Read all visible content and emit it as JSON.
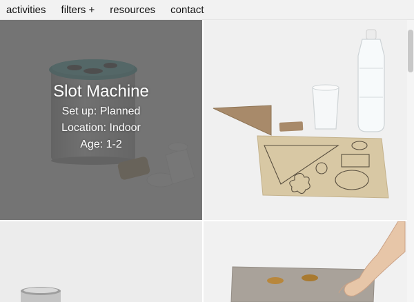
{
  "nav": {
    "items": [
      {
        "label": "activities"
      },
      {
        "label": "filters +"
      },
      {
        "label": "resources"
      },
      {
        "label": "contact"
      }
    ]
  },
  "tiles": [
    {
      "overlay": {
        "title": "Slot Machine",
        "setup": "Set up: Planned",
        "location": "Location: Indoor",
        "age": "Age: 1-2"
      }
    }
  ],
  "colors": {
    "overlay": "#5a5a5a",
    "lid": "#2a8c8c",
    "cardboard": "#a88a6a",
    "fabric": "#d8c8a4"
  }
}
